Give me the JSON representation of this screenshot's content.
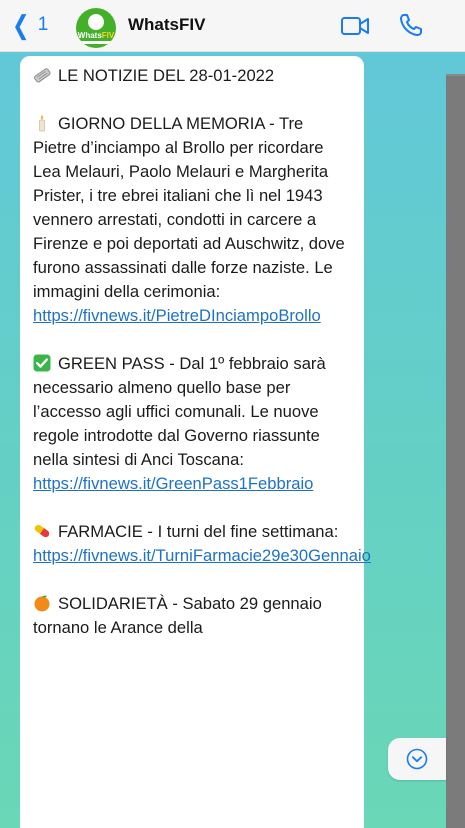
{
  "header": {
    "back_count": "1",
    "title": "WhatsFIV",
    "avatar_brand_left": "Whats",
    "avatar_brand_right": "FIV",
    "accent_color": "#1a7cf5"
  },
  "message": {
    "heading": "LE NOTIZIE DEL 28-01-2022",
    "news1_text": "GIORNO DELLA MEMORIA - Tre Pietre d’inciampo al Brollo per ricordare Lea Melauri, Paolo Melauri e Margherita Prister, i tre ebrei italiani che lì nel 1943 vennero arrestati, condotti in carcere a Firenze e poi deportati ad Auschwitz, dove furono assassinati dalle forze naziste. Le immagini della cerimonia:",
    "news1_link": "https://fivnews.it/PietreDInciampoBrollo",
    "news2_text": "GREEN PASS - Dal 1º febbraio sarà necessario almeno quello base per l’accesso agli uffici comunali. Le nuove regole introdotte dal Governo riassunte nella sintesi di Anci Toscana:",
    "news2_link": "https://fivnews.it/GreenPass1Febbraio",
    "news3_text": "FARMACIE - I turni del fine settimana:",
    "news3_link": "https://fivnews.it/TurniFarmacie29e30Gennaio",
    "news4_text": "SOLIDARIETÀ - Sabato 29 gennaio tornano le Arance della"
  }
}
